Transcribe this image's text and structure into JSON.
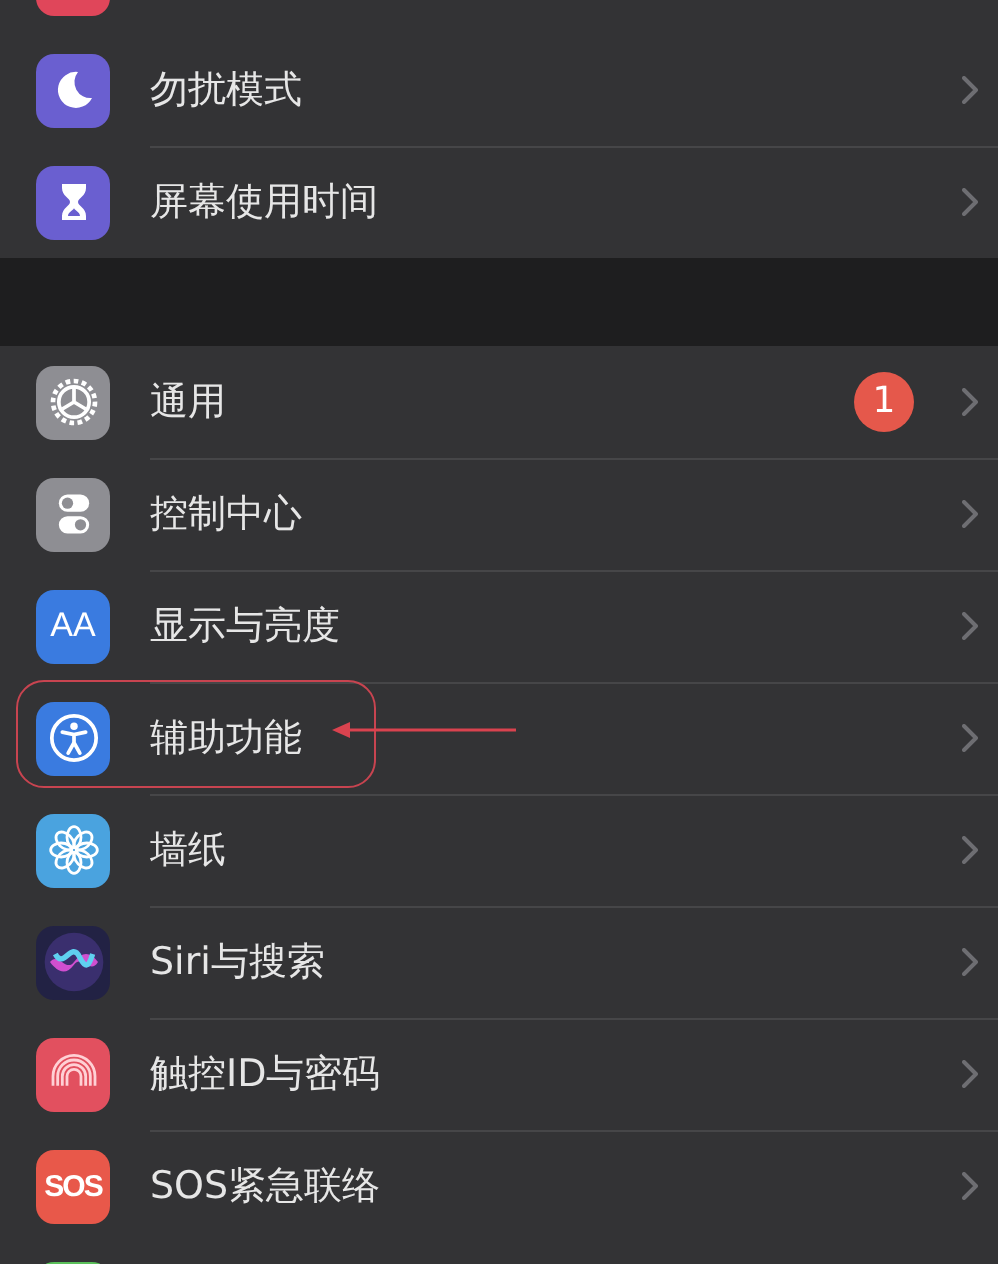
{
  "groups": [
    {
      "rows": [
        {
          "kind": "partial-top",
          "color": "#e0465a"
        },
        {
          "kind": "moon",
          "color": "#6a5fd0",
          "label": "勿扰模式",
          "highlighted": false
        },
        {
          "kind": "hourglass",
          "color": "#6a5fd0",
          "label": "屏幕使用时间",
          "highlighted": false
        }
      ]
    },
    {
      "rows": [
        {
          "kind": "gear",
          "color": "#8e8e93",
          "label": "通用",
          "badge": "1",
          "highlighted": false
        },
        {
          "kind": "toggles",
          "color": "#8e8e93",
          "label": "控制中心",
          "highlighted": false
        },
        {
          "kind": "text",
          "color": "#3a7be0",
          "icon_text": "AA",
          "label": "显示与亮度",
          "highlighted": false
        },
        {
          "kind": "accessibility",
          "color": "#3a7be0",
          "label": "辅助功能",
          "highlighted": true
        },
        {
          "kind": "flower",
          "color": "#4aa3df",
          "label": "墙纸",
          "highlighted": false
        },
        {
          "kind": "siri",
          "color": "#222244",
          "label": "Siri与搜索",
          "highlighted": false
        },
        {
          "kind": "fingerprint",
          "color": "#e2505f",
          "label": "触控ID与密码",
          "highlighted": false
        },
        {
          "kind": "text",
          "color": "#e8584a",
          "icon_text": "SOS",
          "label": "SOS紧急联络",
          "highlighted": false
        },
        {
          "kind": "partial-bottom",
          "color": "#5ac05a"
        }
      ]
    }
  ]
}
